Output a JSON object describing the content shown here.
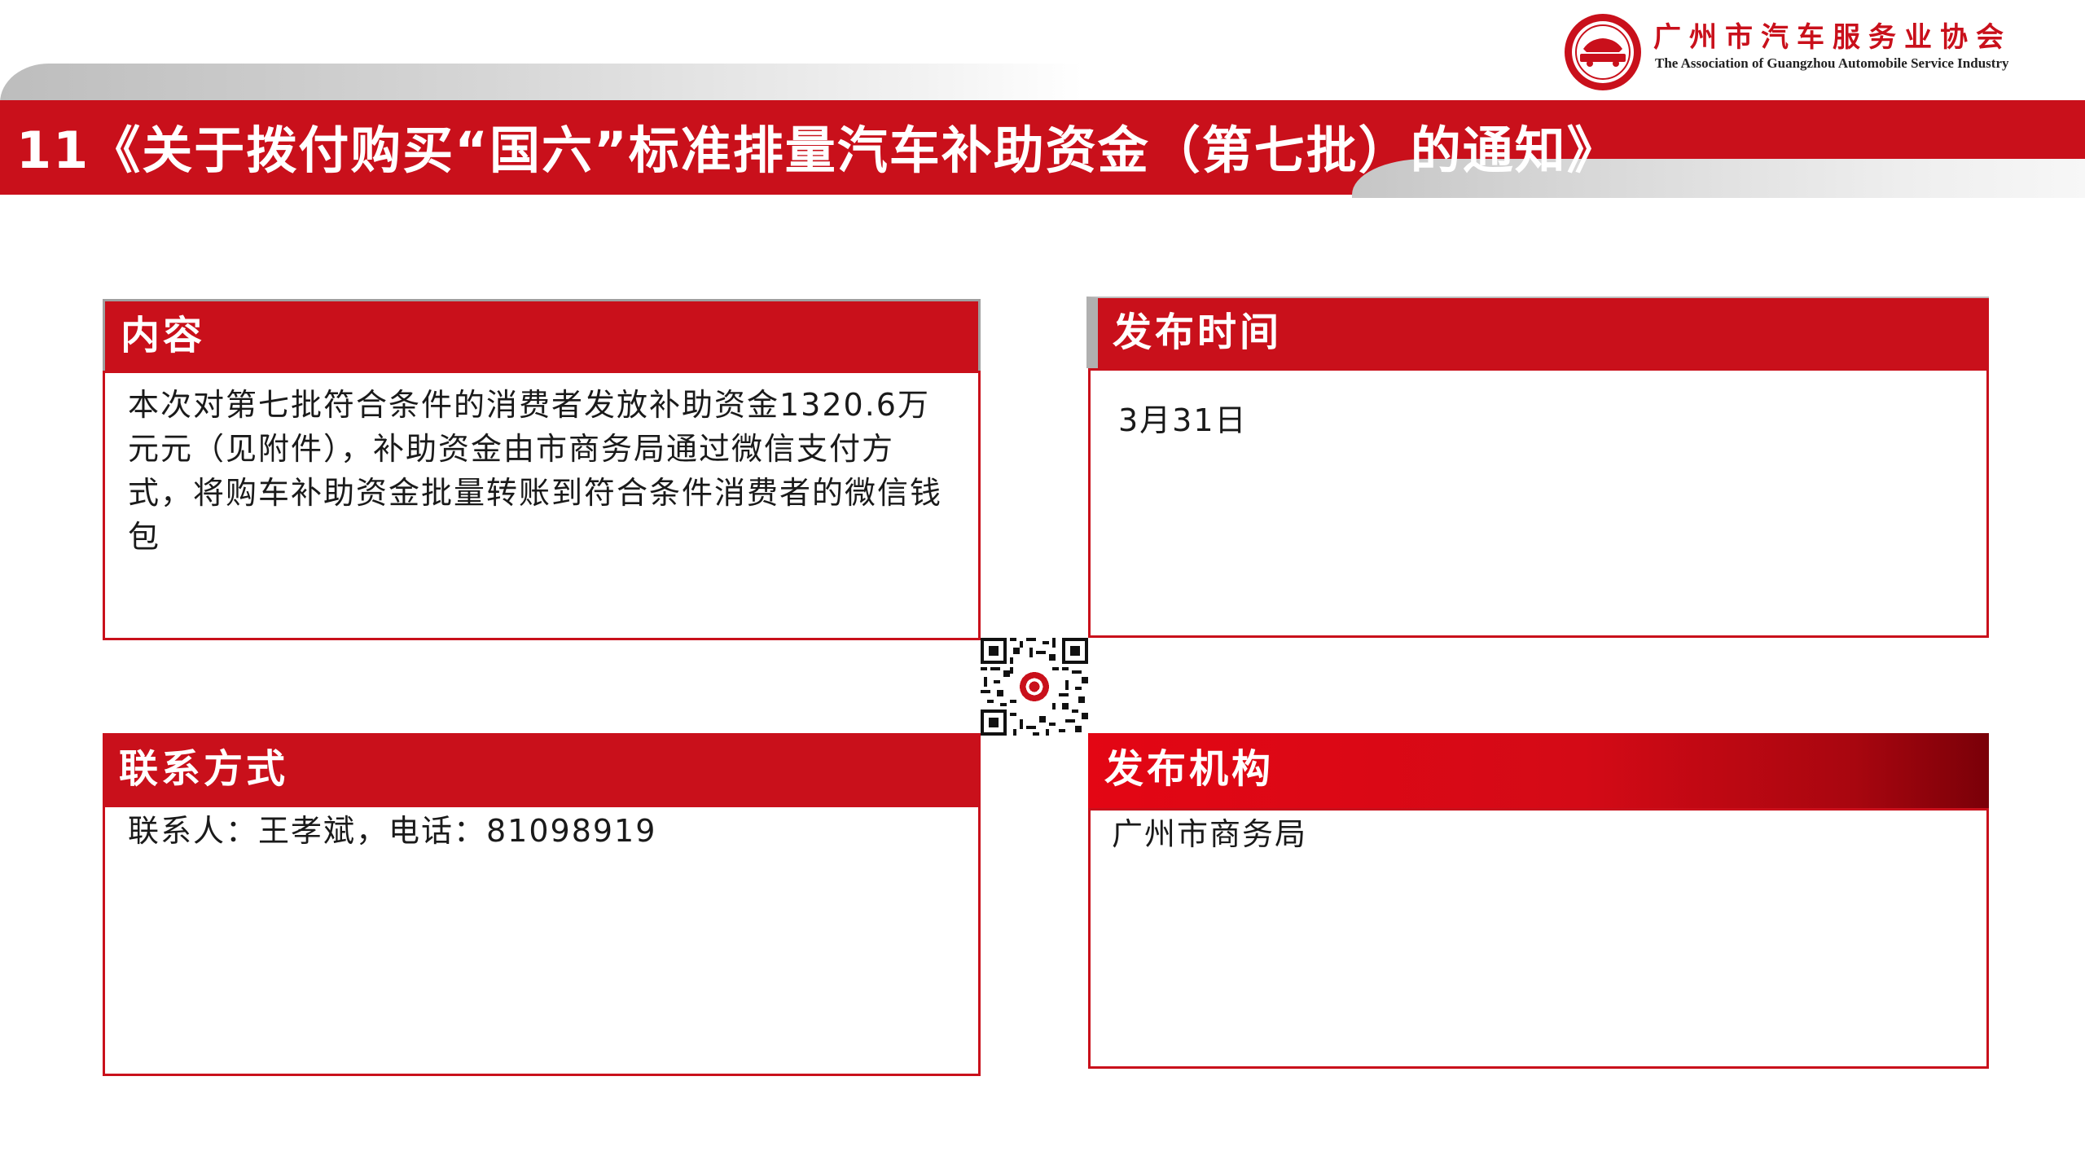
{
  "header": {
    "title": "11《关于拨付购买“国六”标准排量汽车补助资金（第七批）的通知》",
    "accent_color": "#c9101b"
  },
  "logo": {
    "name_cn": "广州市汽车服务业协会",
    "name_en": "The Association of Guangzhou Automobile Service Industry",
    "emblem_icon": "gzasa-emblem-icon"
  },
  "sections": {
    "content": {
      "label": "内容",
      "text": "本次对第七批符合条件的消费者发放补助资金1320.6万元元（见附件），补助资金由市商务局通过微信支付方式，将购车补助资金批量转账到符合条件消费者的微信钱包"
    },
    "release_time": {
      "label": "发布时间",
      "text": "3月31日"
    },
    "contact": {
      "label": "联系方式",
      "text": "联系人：王孝斌，电话：81098919"
    },
    "publisher": {
      "label": "发布机构",
      "text": "广州市商务局"
    }
  },
  "qr_icon": "qr-code-icon"
}
